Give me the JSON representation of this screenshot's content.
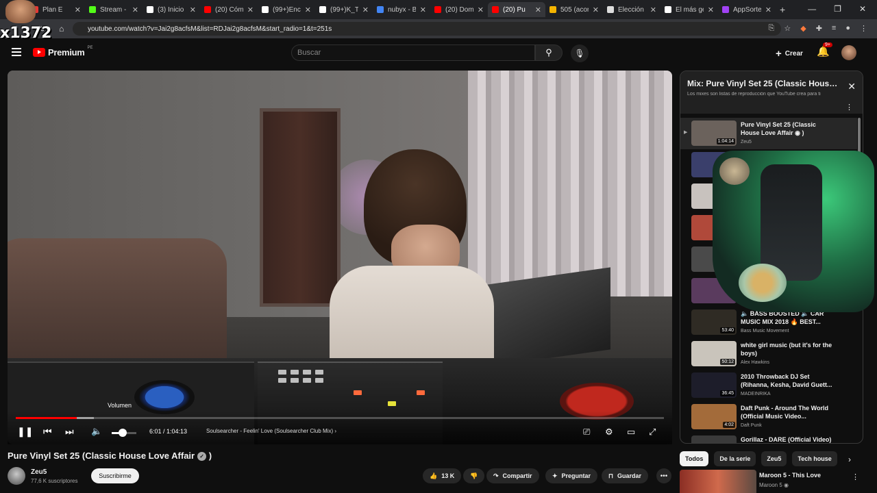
{
  "browser": {
    "tabs": [
      {
        "label": "Plan E",
        "color": "#e53935"
      },
      {
        "label": "Stream - K",
        "color": "#53fc18"
      },
      {
        "label": "(3) Inicio /",
        "color": "#ffffff"
      },
      {
        "label": "(20) Cómo",
        "color": "#ff0000"
      },
      {
        "label": "(99+)Enca",
        "color": "#ffffff"
      },
      {
        "label": "(99+)K_TA",
        "color": "#ffffff"
      },
      {
        "label": "nubyx - Bu",
        "color": "#4285f4"
      },
      {
        "label": "(20) Dom",
        "color": "#ff0000"
      },
      {
        "label": "(20) Pu",
        "color": "#ff0000",
        "active": true
      },
      {
        "label": "505 (acord",
        "color": "#f4b400"
      },
      {
        "label": "Elección d",
        "color": "#dddddd"
      },
      {
        "label": "El más gen",
        "color": "#ffffff"
      },
      {
        "label": "AppSorteo",
        "color": "#a142f4"
      }
    ],
    "new_tab": "+",
    "close_glyph": "✕",
    "url": "youtube.com/watch?v=Jai2g8acfsM&list=RDJai2g8acfsM&start_radio=1&t=251s"
  },
  "streamer_overlay": {
    "counter": "x1372"
  },
  "header": {
    "brand": "Premium",
    "brand_region": "PE",
    "search_placeholder": "Buscar",
    "create_label": "Crear",
    "notification_count": "9+"
  },
  "player": {
    "current_time": "6:01",
    "duration": "1:04:13",
    "time_display": "6:01 / 1:04:13",
    "progress_played": 0.094,
    "progress_loaded": 0.12,
    "volume_level": 0.45,
    "volume_tooltip": "Volumen",
    "chapter": "Soulsearcher - Feelin' Love (Soulsearcher Club Mix)"
  },
  "video": {
    "title": "Pure Vinyl Set 25 (Classic House Love Affair",
    "title_suffix": ")",
    "channel": "Zeu5",
    "subscribers": "77,6 K suscriptores",
    "subscribe_label": "Suscribirme",
    "likes": "13 K",
    "share_label": "Compartir",
    "ask_label": "Preguntar",
    "save_label": "Guardar"
  },
  "playlist": {
    "title": "Mix: Pure Vinyl Set 25 (Classic House Love Affair ◉)",
    "subtitle": "Los mixes son listas de reproducción que YouTube crea para ti",
    "items": [
      {
        "title": "Pure Vinyl Set 25 (Classic House Love Affair ◉ )",
        "channel": "Zeu5",
        "duration": "1:04:14",
        "current": true
      },
      {
        "title": "",
        "channel": "",
        "duration": ""
      },
      {
        "title": "",
        "channel": "",
        "duration": ""
      },
      {
        "title": "",
        "channel": "",
        "duration": ""
      },
      {
        "title": "",
        "channel": "",
        "duration": ""
      },
      {
        "title": "",
        "channel": "",
        "duration": ""
      },
      {
        "title": "🔈 BASS BOOSTED 🔈 CAR MUSIC MIX 2018 🔥 BEST...",
        "channel": "Bass Music Movement",
        "duration": "53:40"
      },
      {
        "title": "white girl music (but it's for the boys)",
        "channel": "Alex Hawkins",
        "duration": "50:12"
      },
      {
        "title": "2010 Throwback DJ Set (Rihanna, Kesha, David Guett...",
        "channel": "MADEINRIKA",
        "duration": "36:45"
      },
      {
        "title": "Daft Punk - Around The World (Official Music Video...",
        "channel": "Daft Punk",
        "duration": "4:02"
      },
      {
        "title": "Gorillaz - DARE (Official Video)",
        "channel": "",
        "duration": ""
      }
    ]
  },
  "chips": [
    "Todos",
    "De la serie",
    "Zeu5",
    "Tech house"
  ],
  "recommendation": {
    "title": "Maroon 5 - This Love",
    "channel": "Maroon 5 ◉"
  }
}
